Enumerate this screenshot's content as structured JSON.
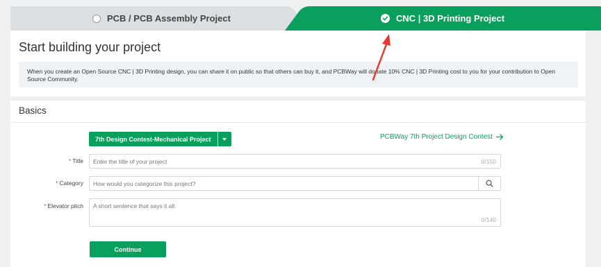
{
  "tabs": [
    {
      "label": "PCB / PCB Assembly Project",
      "selected": false
    },
    {
      "label": "CNC | 3D Printing Project",
      "selected": true
    }
  ],
  "header": {
    "title": "Start building your project",
    "info": "When you create an Open Source CNC | 3D Printing design, you can share it on public so that others can buy it, and PCBWay will donate 10% CNC | 3D Printing cost to you for your contribution to Open Source Community."
  },
  "basics": {
    "section_title": "Basics",
    "contest_select": "7th Design Contest-Mechanical Project",
    "contest_link": "PCBWay 7th Project Design Contest",
    "fields": {
      "title": {
        "label": "Title",
        "placeholder": "Enter the title of your project",
        "counter": "0/150"
      },
      "category": {
        "label": "Category",
        "placeholder": "How would you categorize this project?"
      },
      "pitch": {
        "label": "Elevator pitch",
        "placeholder": "A short sentence that says it all.",
        "counter": "0/140"
      }
    },
    "continue_label": "Continue"
  },
  "colors": {
    "accent": "#08a05c",
    "annotation": "#e8382f"
  },
  "icons": [
    "radio-icon",
    "check-circle-icon",
    "caret-down-icon",
    "arrow-right-icon",
    "search-icon"
  ]
}
